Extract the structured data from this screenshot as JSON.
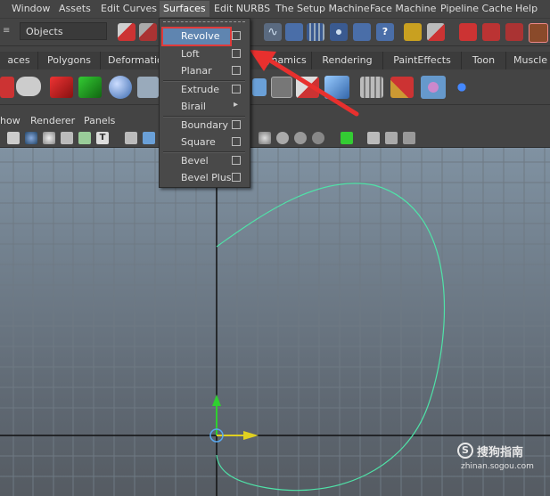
{
  "menubar": {
    "items": [
      "Window",
      "Assets",
      "Edit Curves",
      "Surfaces",
      "Edit NURBS",
      "The Setup Machine",
      "Face Machine",
      "Pipeline Cache",
      "Help"
    ],
    "active": "Surfaces"
  },
  "statusline": {
    "selection_mode": "Objects"
  },
  "shelf": {
    "tabs": [
      "aces",
      "Polygons",
      "Deformatio",
      "ynamics",
      "Rendering",
      "PaintEffects",
      "Toon",
      "Muscle"
    ]
  },
  "panel": {
    "menu": [
      "how",
      "Renderer",
      "Panels"
    ]
  },
  "dropdown": {
    "items": [
      {
        "label": "Revolve",
        "options": true,
        "highlighted": true
      },
      {
        "label": "Loft",
        "options": true
      },
      {
        "label": "Planar",
        "options": true
      },
      {
        "label": "Extrude",
        "options": true
      },
      {
        "label": "Birail",
        "submenu": true
      },
      {
        "label": "Boundary",
        "options": true
      },
      {
        "label": "Square",
        "options": true
      },
      {
        "label": "Bevel",
        "options": true
      },
      {
        "label": "Bevel Plus",
        "options": true
      }
    ],
    "submenu_arrow": "▸"
  },
  "annotation": {
    "arrow_color": "#e8302e",
    "highlight_color": "#e03a3a"
  },
  "viewport": {
    "curve_color": "#4fe3a8",
    "axis_y_color": "#2fd02f",
    "axis_x_color": "#e0d020"
  },
  "watermark": {
    "logo": "S",
    "title": "搜狗指南",
    "url": "zhinan.sogou.com"
  }
}
